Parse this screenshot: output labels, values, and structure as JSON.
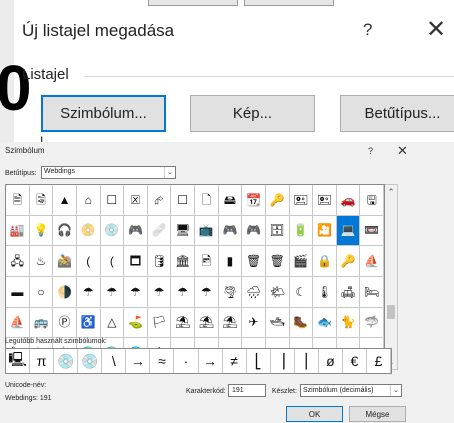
{
  "top_dialog": {
    "title": "Új listajel megadása",
    "help": "?",
    "close": "✕",
    "section_label": "Listajel",
    "background_char": "0",
    "buttons": {
      "symbol": "Szimbólum...",
      "picture": "Kép...",
      "font": "Betűtípus..."
    },
    "cut_text": "I   ..."
  },
  "symbol_dialog": {
    "title": "Szimbólum",
    "help": "?",
    "close": "✕",
    "font_label": "Betűtípus:",
    "font_value": "Webdings",
    "symbols": [
      [
        "🗎",
        "🗟",
        "▲",
        "⌂",
        "☐",
        "🗵",
        "⮳",
        "☐",
        "🗋",
        "🖴",
        "📆",
        "🔑",
        "🖭",
        "🖭",
        "🚗",
        "🖫",
        "🎵",
        "♫"
      ],
      [
        "🏭",
        "💡",
        "🎧",
        "📀",
        "💿",
        "🎮",
        "🩹",
        "🖥",
        "📺",
        "🎮",
        "🎮",
        "🗄",
        "🔋",
        "🎦",
        "💻",
        "📼",
        "💾",
        "🖍"
      ],
      [
        "🖧",
        "♨",
        "🚵",
        "(",
        "(",
        "🗖",
        "🛢",
        "🏛",
        "🖻",
        "▮",
        "🗑",
        "🗑",
        "🎬",
        "🔒",
        "🔑",
        "⛵",
        "⛵",
        "🗑"
      ],
      [
        "▬",
        "○",
        "🌗",
        "☂",
        "☂",
        "☂",
        "☂",
        "☂",
        "☂",
        "🌪",
        "🌧",
        "🌤",
        "☾",
        "🌡",
        "🛋",
        "🛏",
        "🍽",
        "T"
      ],
      [
        "⛵",
        "🚌",
        "Ⓟ",
        "♿",
        "△",
        "⛳",
        "🏳",
        "⛱",
        "⛱",
        "⛱",
        "✈",
        "🛥",
        "🥾",
        "🐟",
        "🐈",
        "🦈",
        "🐄",
        "🪶"
      ],
      [
        "🦅",
        "🦴",
        "🐇",
        "🌍",
        "🌍",
        "🌐",
        "🕸",
        "",
        "",
        "",
        "",
        "",
        "",
        "",
        "",
        "",
        "",
        ""
      ]
    ],
    "selected_index": [
      1,
      14
    ],
    "recent_label": "Legutóbb használt szimbólumok:",
    "recent": [
      "🖳",
      "π",
      "💿",
      "💿",
      "\\",
      "→",
      "≈",
      "·",
      "→",
      "≠",
      "⎣",
      "⎟",
      "⎪",
      "ø",
      "€",
      "£",
      "¥",
      "©"
    ],
    "unicode_name_label": "Unicode-név:",
    "unicode_info": "Webdings: 191",
    "char_code_label": "Karakterkód:",
    "char_code_value": "191",
    "set_label": "Készlet:",
    "set_value": "Szimbólum (decimális)",
    "ok": "OK",
    "cancel": "Mégse"
  }
}
